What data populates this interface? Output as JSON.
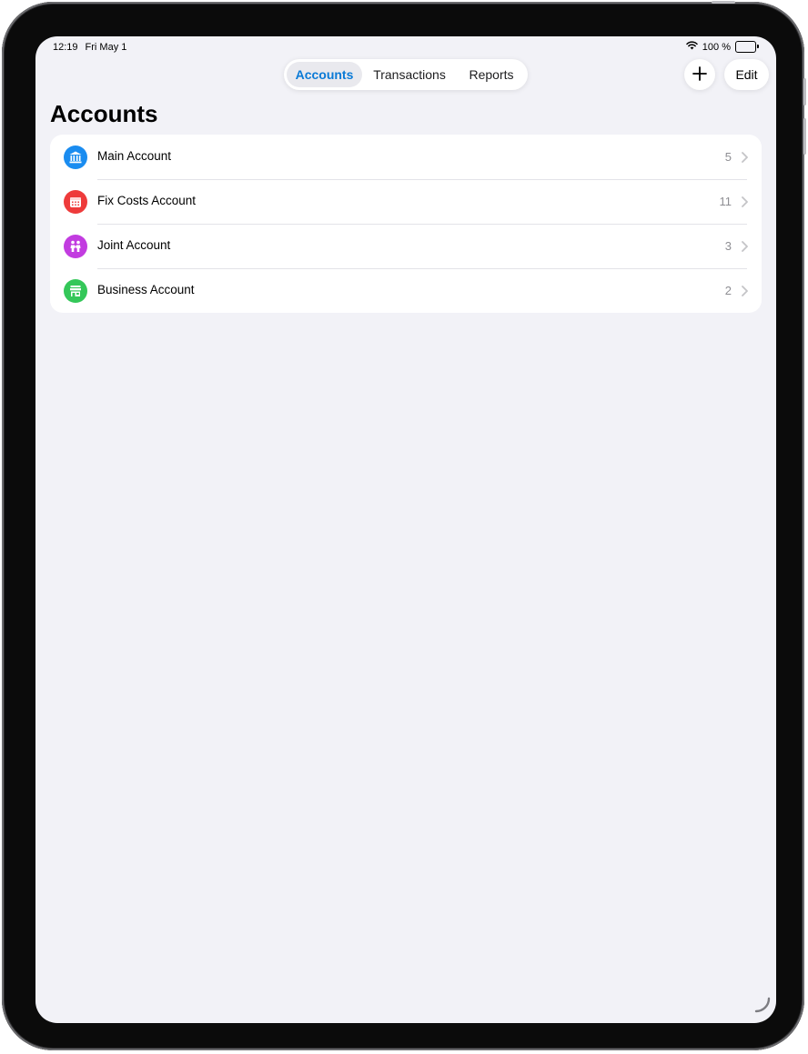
{
  "status": {
    "time": "12:19",
    "date": "Fri May 1",
    "battery": "100 %"
  },
  "nav": {
    "tabs": [
      {
        "label": "Accounts",
        "selected": true
      },
      {
        "label": "Transactions",
        "selected": false
      },
      {
        "label": "Reports",
        "selected": false
      }
    ],
    "add_icon": "plus-icon",
    "edit_label": "Edit"
  },
  "page": {
    "title": "Accounts"
  },
  "accounts": [
    {
      "name": "Main Account",
      "count": "5",
      "icon": "bank-icon",
      "color": "#1a8cf0"
    },
    {
      "name": "Fix Costs Account",
      "count": "11",
      "icon": "calendar-icon",
      "color": "#ee3b3b"
    },
    {
      "name": "Joint Account",
      "count": "3",
      "icon": "people-icon",
      "color": "#c23ce0"
    },
    {
      "name": "Business Account",
      "count": "2",
      "icon": "storefront-icon",
      "color": "#34c759"
    }
  ],
  "colors": {
    "accent": "#0a7ad6",
    "background": "#f2f2f7",
    "secondary_text": "#8e8e93"
  }
}
